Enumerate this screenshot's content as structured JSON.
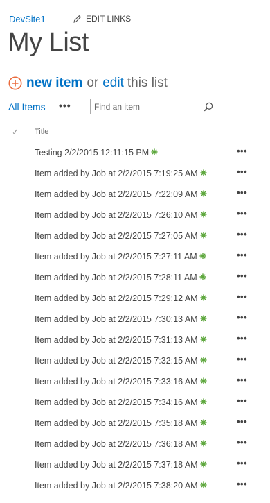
{
  "header": {
    "site_link": "DevSite1",
    "edit_links_label": "EDIT LINKS"
  },
  "page_title": "My List",
  "commands": {
    "new_item": "new item",
    "or": "or",
    "edit": "edit",
    "this_list": "this list"
  },
  "views": {
    "all_items": "All Items",
    "more": "•••",
    "search_placeholder": "Find an item"
  },
  "list": {
    "check_header": "✓",
    "title_header": "Title",
    "row_menu": "•••",
    "rows": [
      {
        "title": "Testing 2/2/2015 12:11:15 PM"
      },
      {
        "title": "Item added by Job at 2/2/2015 7:19:25 AM"
      },
      {
        "title": "Item added by Job at 2/2/2015 7:22:09 AM"
      },
      {
        "title": "Item added by Job at 2/2/2015 7:26:10 AM"
      },
      {
        "title": "Item added by Job at 2/2/2015 7:27:05 AM"
      },
      {
        "title": "Item added by Job at 2/2/2015 7:27:11 AM"
      },
      {
        "title": "Item added by Job at 2/2/2015 7:28:11 AM"
      },
      {
        "title": "Item added by Job at 2/2/2015 7:29:12 AM"
      },
      {
        "title": "Item added by Job at 2/2/2015 7:30:13 AM"
      },
      {
        "title": "Item added by Job at 2/2/2015 7:31:13 AM"
      },
      {
        "title": "Item added by Job at 2/2/2015 7:32:15 AM"
      },
      {
        "title": "Item added by Job at 2/2/2015 7:33:16 AM"
      },
      {
        "title": "Item added by Job at 2/2/2015 7:34:16 AM"
      },
      {
        "title": "Item added by Job at 2/2/2015 7:35:18 AM"
      },
      {
        "title": "Item added by Job at 2/2/2015 7:36:18 AM"
      },
      {
        "title": "Item added by Job at 2/2/2015 7:37:18 AM"
      },
      {
        "title": "Item added by Job at 2/2/2015 7:38:20 AM"
      }
    ]
  },
  "colors": {
    "link": "#0072c6",
    "text": "#444444",
    "add_icon": "#ea6b3d",
    "new_badge": "#5ba63a"
  },
  "icons": {
    "edit_links": "pencil-icon",
    "add": "add-circle-icon",
    "search": "search-icon",
    "new_badge": "new-item-badge-icon"
  }
}
